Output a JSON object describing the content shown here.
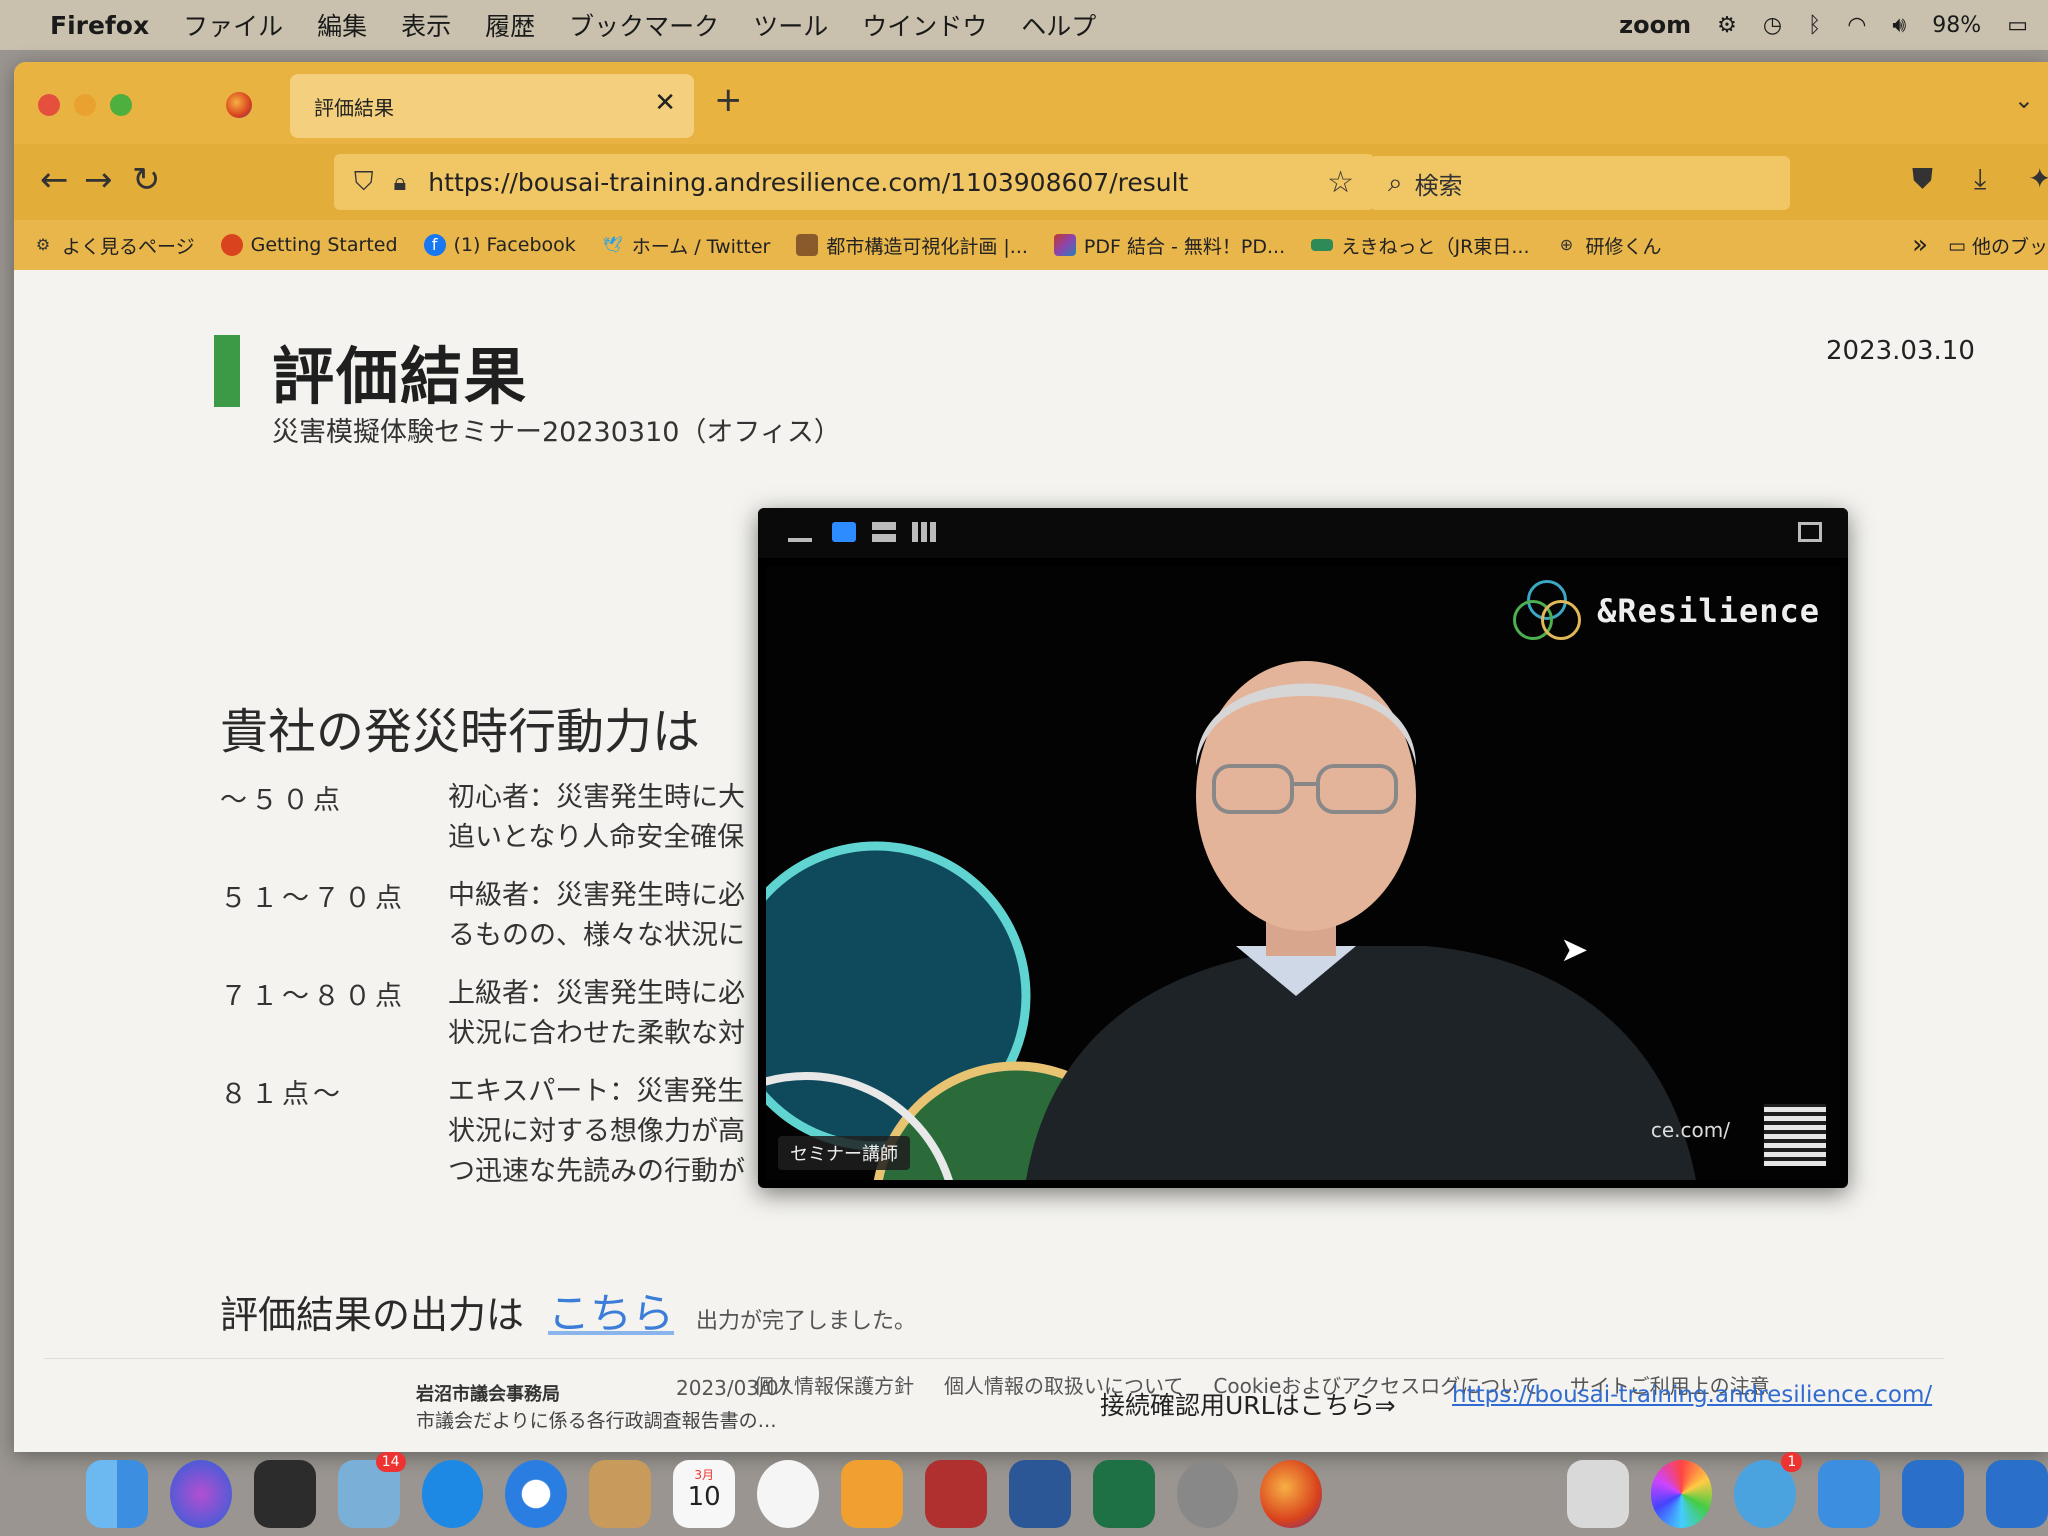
{
  "menubar": {
    "app_name": "Firefox",
    "items": [
      "ファイル",
      "編集",
      "表示",
      "履歴",
      "ブックマーク",
      "ツール",
      "ウインドウ",
      "ヘルプ"
    ],
    "zoom_label": "zoom",
    "battery": "98%"
  },
  "browser": {
    "tab_title": "評価結果",
    "url": "https://bousai-training.andresilience.com/1103908607/result",
    "search_placeholder": "検索",
    "bookmarks": [
      {
        "label": "よく見るページ",
        "icon": "gear-icon",
        "color": "#333333"
      },
      {
        "label": "Getting Started",
        "icon": "firefox-icon",
        "color": "#d9431d"
      },
      {
        "label": "(1) Facebook",
        "icon": "facebook-icon",
        "color": "#1877f2"
      },
      {
        "label": "ホーム / Twitter",
        "icon": "twitter-icon",
        "color": "#1da1f2"
      },
      {
        "label": "都市構造可視化計画 |...",
        "icon": "map-icon",
        "color": "#8b5a2b"
      },
      {
        "label": "PDF 結合 - 無料！PD...",
        "icon": "pdf-icon",
        "color": "#c0392b"
      },
      {
        "label": "えきねっと（JR東日...",
        "icon": "train-icon",
        "color": "#2e8b57"
      },
      {
        "label": "研修くん",
        "icon": "globe-icon",
        "color": "#333333"
      }
    ],
    "other_bookmarks": "他のブッ"
  },
  "page": {
    "title": "評価結果",
    "subtitle": "災害模擬体験セミナー20230310（オフィス）",
    "date": "2023.03.10",
    "section_heading": "貴社の発災時行動力は",
    "score_levels": [
      {
        "range": "～５０点",
        "desc_lines": [
          "初心者：災害発生時に大",
          "追いとなり人命安全確保"
        ]
      },
      {
        "range": "５１～７０点",
        "desc_lines": [
          "中級者：災害発生時に必",
          "るものの、様々な状況に"
        ]
      },
      {
        "range": "７１～８０点",
        "desc_lines": [
          "上級者：災害発生時に必",
          "状況に合わせた柔軟な対"
        ]
      },
      {
        "range": "８１点～",
        "desc_lines": [
          "エキスパート：災害発生",
          "状況に対する想像力が高",
          "つ迅速な先読みの行動が"
        ]
      }
    ],
    "output_label": "評価結果の出力は",
    "output_link": "こちら",
    "output_status": "出力が完了しました。",
    "footer_links": [
      "個人情報保護方針",
      "個人情報の取扱いについて",
      "Cookieおよびアクセスログについて",
      "サイトご利用上の注意"
    ]
  },
  "zoom_video": {
    "brand": "&Resilience",
    "speaker_label": "セミナー講師",
    "background_url": "ce.com/"
  },
  "mail": {
    "from": "岩沼市議会事務局",
    "date": "2023/03/07",
    "subject": "市議会だよりに係る各行政調査報告書の…",
    "connection_label": "接続確認用URLはこちら⇒",
    "connection_url": "https://bousai-training.andresilience.com/"
  },
  "dock": {
    "mail_badge": "14",
    "calendar_month": "3月",
    "calendar_day": "10",
    "messages_badge": "1"
  }
}
